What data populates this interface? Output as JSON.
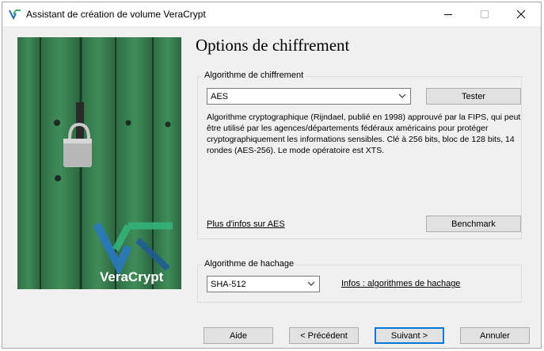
{
  "window": {
    "title": "Assistant de création de volume VeraCrypt"
  },
  "banner": {
    "logo_text": "VeraCrypt"
  },
  "page": {
    "heading": "Options de chiffrement"
  },
  "encryption": {
    "group_label": "Algorithme de chiffrement",
    "selected_algorithm": "AES",
    "test_button": "Tester",
    "description": "Algorithme cryptographique (Rijndael, publié en 1998) approuvé par la FIPS, qui peut être utilisé par les agences/départements fédéraux américains pour protéger cryptographiquement les informations sensibles. Clé à 256 bits, bloc de 128 bits, 14 rondes (AES-256). Le mode opératoire est XTS.",
    "more_info_link": "Plus d'infos sur AES",
    "benchmark_button": "Benchmark"
  },
  "hash": {
    "group_label": "Algorithme de hachage",
    "selected_algorithm": "SHA-512",
    "info_link": "Infos : algorithmes de hachage"
  },
  "footer": {
    "help_button": "Aide",
    "previous_button": "< Précédent",
    "next_button": "Suivant >",
    "cancel_button": "Annuler"
  }
}
